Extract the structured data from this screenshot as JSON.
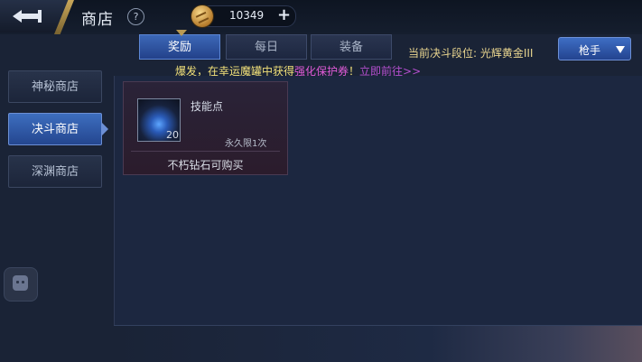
{
  "header": {
    "title": "商店",
    "help_symbol": "?",
    "currency": {
      "value": "10349",
      "icon": "coin-icon",
      "add_symbol": "+"
    }
  },
  "tabs": [
    {
      "label": "奖励",
      "active": true
    },
    {
      "label": "每日",
      "active": false
    },
    {
      "label": "装备",
      "active": false
    }
  ],
  "rank": {
    "label": "当前决斗段位: 光辉黄金III"
  },
  "class_select": {
    "value": "枪手"
  },
  "marquee": {
    "part1": "爆发，在幸运魔罐中获得",
    "part2": "强化保护券",
    "part3": "！",
    "part4": "立即前往>>"
  },
  "sidebar": {
    "items": [
      {
        "label": "神秘商店",
        "active": false
      },
      {
        "label": "决斗商店",
        "active": true
      },
      {
        "label": "深渊商店",
        "active": false
      }
    ]
  },
  "items": [
    {
      "name": "技能点",
      "quantity": "20",
      "limit": "永久限1次",
      "price_text": "不朽钻石可购买",
      "icon": "skill-orb-icon"
    }
  ],
  "colors": {
    "accent_blue": "#3c68b7",
    "gold_text": "#e9d58f",
    "highlight_pink": "#e05bd8",
    "highlight_purple": "#b54fd0"
  }
}
